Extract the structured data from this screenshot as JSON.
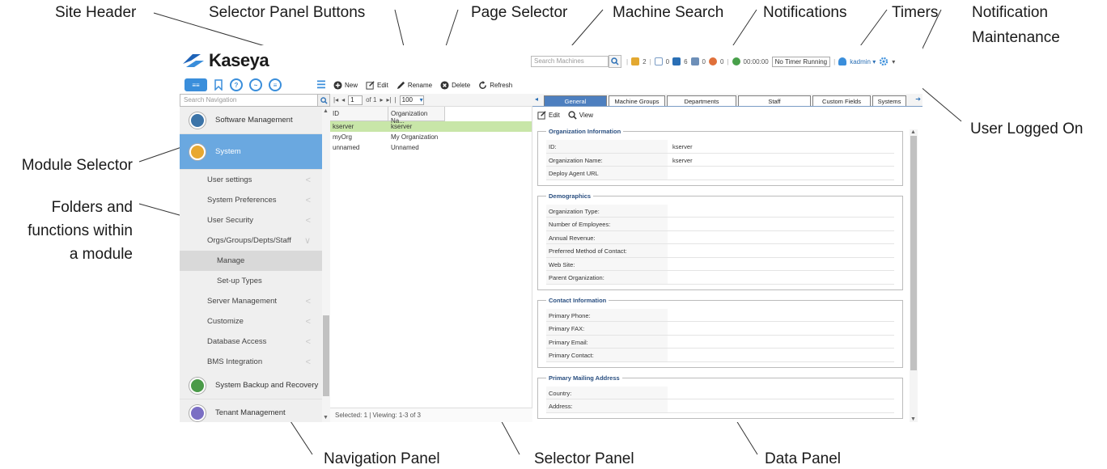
{
  "callouts": {
    "site_header": "Site Header",
    "selector_panel_buttons": "Selector Panel Buttons",
    "page_selector": "Page Selector",
    "machine_search": "Machine Search",
    "notifications": "Notifications",
    "timers": "Timers",
    "notification_maintenance_1": "Notification",
    "notification_maintenance_2": "Maintenance",
    "user_logged_on": "User Logged On",
    "module_selector": "Module Selector",
    "folders_1": "Folders and",
    "folders_2": "functions within",
    "folders_3": "a module",
    "navigation_panel": "Navigation Panel",
    "selector_panel": "Selector Panel",
    "data_panel": "Data Panel"
  },
  "header": {
    "logo_text": "Kaseya",
    "search_placeholder": "Search Machines",
    "counts": {
      "agents": "2",
      "mail": "0",
      "online": "6",
      "offline": "0",
      "alarms": "0"
    },
    "timer": "00:00:00",
    "timer_status": "No Timer Running",
    "user": "kadmin ▾",
    "maintenance_caret": "▾"
  },
  "nav": {
    "search_placeholder": "Search Navigation",
    "modules": [
      {
        "label": "Software Management",
        "color": "#3c74a8"
      },
      {
        "label": "System",
        "color": "#e8a830"
      },
      {
        "label": "System Backup and Recovery",
        "color": "#4a9a48"
      },
      {
        "label": "Tenant Management",
        "color": "#7b6fc4"
      }
    ],
    "functions": [
      {
        "label": "User settings",
        "chev": "<"
      },
      {
        "label": "System Preferences",
        "chev": "<"
      },
      {
        "label": "User Security",
        "chev": "<"
      },
      {
        "label": "Orgs/Groups/Depts/Staff",
        "chev": "∨"
      },
      {
        "label": "Manage",
        "chev": ""
      },
      {
        "label": "Set-up Types",
        "chev": ""
      },
      {
        "label": "Server Management",
        "chev": "<"
      },
      {
        "label": "Customize",
        "chev": "<"
      },
      {
        "label": "Database Access",
        "chev": "<"
      },
      {
        "label": "BMS Integration",
        "chev": "<"
      }
    ]
  },
  "selector": {
    "buttons": {
      "new": "New",
      "edit": "Edit",
      "rename": "Rename",
      "delete": "Delete",
      "refresh": "Refresh"
    },
    "pager": {
      "page": "1",
      "of": "of 1",
      "page_size": "100"
    },
    "columns": [
      "ID",
      "Organization Na..."
    ],
    "rows": [
      [
        "kserver",
        "kserver"
      ],
      [
        "myOrg",
        "My Organization"
      ],
      [
        "unnamed",
        "Unnamed"
      ]
    ],
    "status": "Selected:  1  |  Viewing:  1-3  of  3"
  },
  "data_panel": {
    "tabs": [
      "General",
      "Machine Groups",
      "Departments",
      "Staff",
      "Custom Fields",
      "Systems"
    ],
    "active_tab": "General",
    "toolbar": {
      "edit": "Edit",
      "view": "View"
    },
    "groups": [
      {
        "title": "Organization Information",
        "fields": [
          {
            "label": "ID:",
            "value": "kserver"
          },
          {
            "label": "Organization Name:",
            "value": "kserver"
          },
          {
            "label": "Deploy Agent URL",
            "value": ""
          }
        ]
      },
      {
        "title": "Demographics",
        "fields": [
          {
            "label": "Organization Type:",
            "value": ""
          },
          {
            "label": "Number of Employees:",
            "value": ""
          },
          {
            "label": "Annual Revenue:",
            "value": ""
          },
          {
            "label": "Preferred Method of Contact:",
            "value": ""
          },
          {
            "label": "Web Site:",
            "value": ""
          },
          {
            "label": "Parent Organization:",
            "value": ""
          }
        ]
      },
      {
        "title": "Contact Information",
        "fields": [
          {
            "label": "Primary Phone:",
            "value": ""
          },
          {
            "label": "Primary FAX:",
            "value": ""
          },
          {
            "label": "Primary Email:",
            "value": ""
          },
          {
            "label": "Primary Contact:",
            "value": ""
          }
        ]
      },
      {
        "title": "Primary Mailing Address",
        "fields": [
          {
            "label": "Country:",
            "value": ""
          },
          {
            "label": "Address:",
            "value": ""
          }
        ]
      }
    ]
  }
}
